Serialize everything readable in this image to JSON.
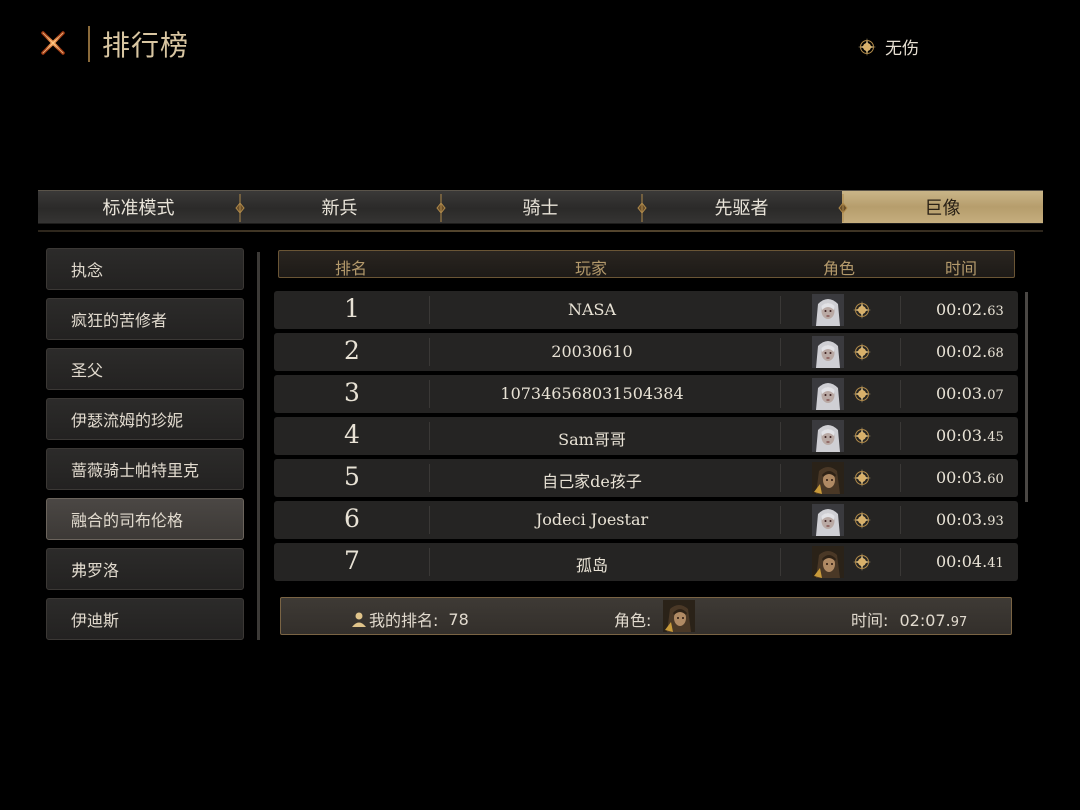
{
  "header": {
    "title": "排行榜",
    "no_damage_label": "无伤"
  },
  "tabs": [
    {
      "label": "标准模式",
      "active": false
    },
    {
      "label": "新兵",
      "active": false
    },
    {
      "label": "骑士",
      "active": false
    },
    {
      "label": "先驱者",
      "active": false
    },
    {
      "label": "巨像",
      "active": true
    }
  ],
  "bosses": [
    {
      "label": "执念",
      "active": false
    },
    {
      "label": "疯狂的苦修者",
      "active": false
    },
    {
      "label": "圣父",
      "active": false
    },
    {
      "label": "伊瑟流姆的珍妮",
      "active": false
    },
    {
      "label": "蔷薇骑士帕特里克",
      "active": false
    },
    {
      "label": "融合的司布伦格",
      "active": true
    },
    {
      "label": "弗罗洛",
      "active": false
    },
    {
      "label": "伊迪斯",
      "active": false
    }
  ],
  "table": {
    "headers": {
      "rank": "排名",
      "player": "玩家",
      "role": "角色",
      "time": "时间"
    },
    "rows": [
      {
        "rank": "1",
        "player": "NASA",
        "role_icon": "silver-hair-portrait",
        "time_main": "00:02.",
        "time_ms": "63"
      },
      {
        "rank": "2",
        "player": "20030610",
        "role_icon": "silver-hair-portrait",
        "time_main": "00:02.",
        "time_ms": "68"
      },
      {
        "rank": "3",
        "player": "107346568031504384",
        "role_icon": "silver-hair-portrait",
        "time_main": "00:03.",
        "time_ms": "07"
      },
      {
        "rank": "4",
        "player": "Sam哥哥",
        "role_icon": "silver-hair-portrait",
        "time_main": "00:03.",
        "time_ms": "45"
      },
      {
        "rank": "5",
        "player": "自己家de孩子",
        "role_icon": "dark-hair-portrait",
        "time_main": "00:03.",
        "time_ms": "60"
      },
      {
        "rank": "6",
        "player": "Jodeci Joestar",
        "role_icon": "silver-hair-portrait",
        "time_main": "00:03.",
        "time_ms": "93"
      },
      {
        "rank": "7",
        "player": "孤岛",
        "role_icon": "dark-hair-portrait",
        "time_main": "00:04.",
        "time_ms": "41"
      }
    ]
  },
  "my_rank": {
    "rank_label": "我的排名:",
    "rank_value": "78",
    "role_label": "角色:",
    "role_icon": "dark-hair-portrait",
    "time_label": "时间:",
    "time_main": "02:07.",
    "time_ms": "97"
  },
  "colors": {
    "accent_gold": "#c9b588",
    "border_bronze": "#7a6444",
    "row_bg": "#252423"
  }
}
